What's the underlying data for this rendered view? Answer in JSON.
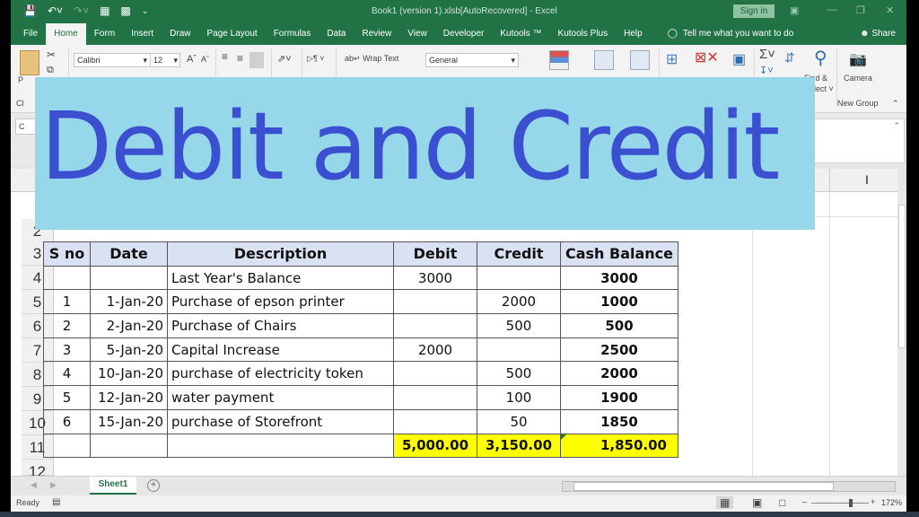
{
  "window": {
    "title": "Book1 (version 1).xlsb[AutoRecovered]  -  Excel",
    "sign_in": "Sign in"
  },
  "menu": {
    "tabs": [
      "File",
      "Home",
      "Form",
      "Insert",
      "Draw",
      "Page Layout",
      "Formulas",
      "Data",
      "Review",
      "View",
      "Developer",
      "Kutools ™",
      "Kutools Plus",
      "Help"
    ],
    "active_tab": "Home",
    "tell_me": "Tell me what you want to do",
    "share": "Share"
  },
  "ribbon": {
    "font_name": "Calibri",
    "font_size": "12",
    "wrap_text": "Wrap Text",
    "number_format": "General",
    "find_select": "Find &",
    "find_select_2": "Select ˅",
    "camera": "Camera",
    "new_group": "New Group",
    "paste_fragment": "P",
    "clipboard_fragment": "Cl",
    "namebox_fragment": "C"
  },
  "banner": {
    "text": "Debit and Credit",
    "bg_color": "#97d7ea",
    "text_color": "#3b4fd1"
  },
  "sheet": {
    "row_numbers": [
      "2",
      "3",
      "4",
      "5",
      "6",
      "7",
      "8",
      "9",
      "10",
      "11",
      "12"
    ],
    "headers": [
      "S no",
      "Date",
      "Description",
      "Debit",
      "Credit",
      "Cash Balance"
    ],
    "rows": [
      {
        "sno": "",
        "date": "",
        "desc": "Last Year's Balance",
        "debit": "3000",
        "credit": "",
        "balance": "3000"
      },
      {
        "sno": "1",
        "date": "1-Jan-20",
        "desc": "Purchase of epson printer",
        "debit": "",
        "credit": "2000",
        "balance": "1000"
      },
      {
        "sno": "2",
        "date": "2-Jan-20",
        "desc": "Purchase of Chairs",
        "debit": "",
        "credit": "500",
        "balance": "500"
      },
      {
        "sno": "3",
        "date": "5-Jan-20",
        "desc": "Capital Increase",
        "debit": "2000",
        "credit": "",
        "balance": "2500"
      },
      {
        "sno": "4",
        "date": "10-Jan-20",
        "desc": "purchase of electricity token",
        "debit": "",
        "credit": "500",
        "balance": "2000"
      },
      {
        "sno": "5",
        "date": "12-Jan-20",
        "desc": "water payment",
        "debit": "",
        "credit": "100",
        "balance": "1900"
      },
      {
        "sno": "6",
        "date": "15-Jan-20",
        "desc": "purchase of Storefront",
        "debit": "",
        "credit": "50",
        "balance": "1850"
      }
    ],
    "totals": {
      "debit": "5,000.00",
      "credit": "3,150.00",
      "balance": "1,850.00"
    },
    "header_fill": "#d9e1f2",
    "total_fill": "#ffff00"
  },
  "sheet_tabs": {
    "active": "Sheet1",
    "add_label": "+"
  },
  "status": {
    "ready": "Ready",
    "zoom": "172%"
  }
}
